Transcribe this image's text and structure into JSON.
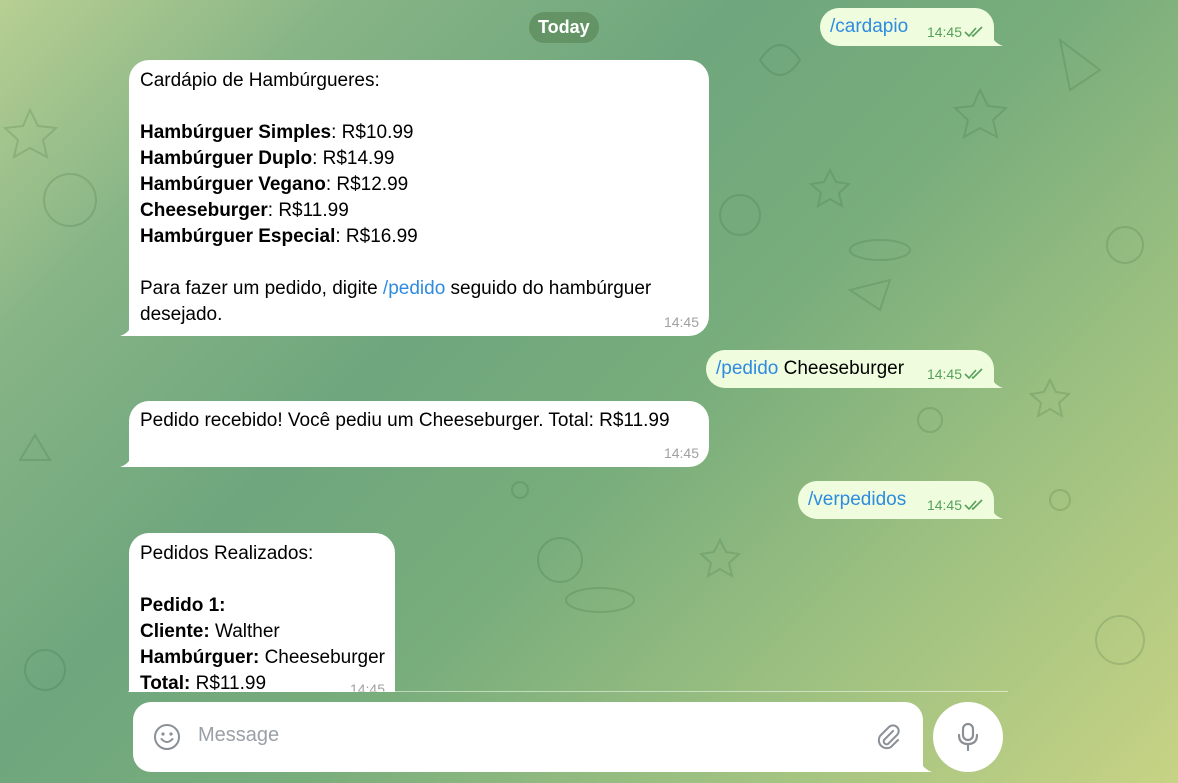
{
  "date_separator": "Today",
  "messages": {
    "m1": {
      "text": "/cardapio",
      "time": "14:45"
    },
    "m2": {
      "title": "Cardápio de Hambúrgueres:",
      "items": [
        {
          "name": "Hambúrguer Simples",
          "price": ": R$10.99"
        },
        {
          "name": "Hambúrguer Duplo",
          "price": ": R$14.99"
        },
        {
          "name": "Hambúrguer Vegano",
          "price": ": R$12.99"
        },
        {
          "name": "Cheeseburger",
          "price": ": R$11.99"
        },
        {
          "name": "Hambúrguer Especial",
          "price": ": R$16.99"
        }
      ],
      "footer_before": "Para fazer um pedido, digite ",
      "footer_link": "/pedido",
      "footer_after": " seguido do hambúrguer",
      "footer_line2": "desejado.",
      "time": "14:45"
    },
    "m3": {
      "command": "/pedido",
      "arg": " Cheeseburger",
      "time": "14:45"
    },
    "m4": {
      "text": "Pedido recebido! Você pediu um Cheeseburger. Total: R$11.99",
      "time": "14:45"
    },
    "m5": {
      "text": "/verpedidos",
      "time": "14:45"
    },
    "m6": {
      "title": "Pedidos Realizados:",
      "order_label": "Pedido 1:",
      "client_label": "Cliente:",
      "client_value": " Walther",
      "burger_label": "Hambúrguer:",
      "burger_value": " Cheeseburger",
      "total_label": "Total:",
      "total_value": " R$11.99",
      "time": "14:45"
    }
  },
  "composer": {
    "placeholder": "Message",
    "emoji_icon": "smile-icon",
    "attach_icon": "paperclip-icon",
    "mic_icon": "microphone-icon"
  },
  "colors": {
    "incoming_bubble": "#ffffff",
    "outgoing_bubble": "#effdde",
    "link": "#2e8be0",
    "read_checks": "#56a05c"
  }
}
